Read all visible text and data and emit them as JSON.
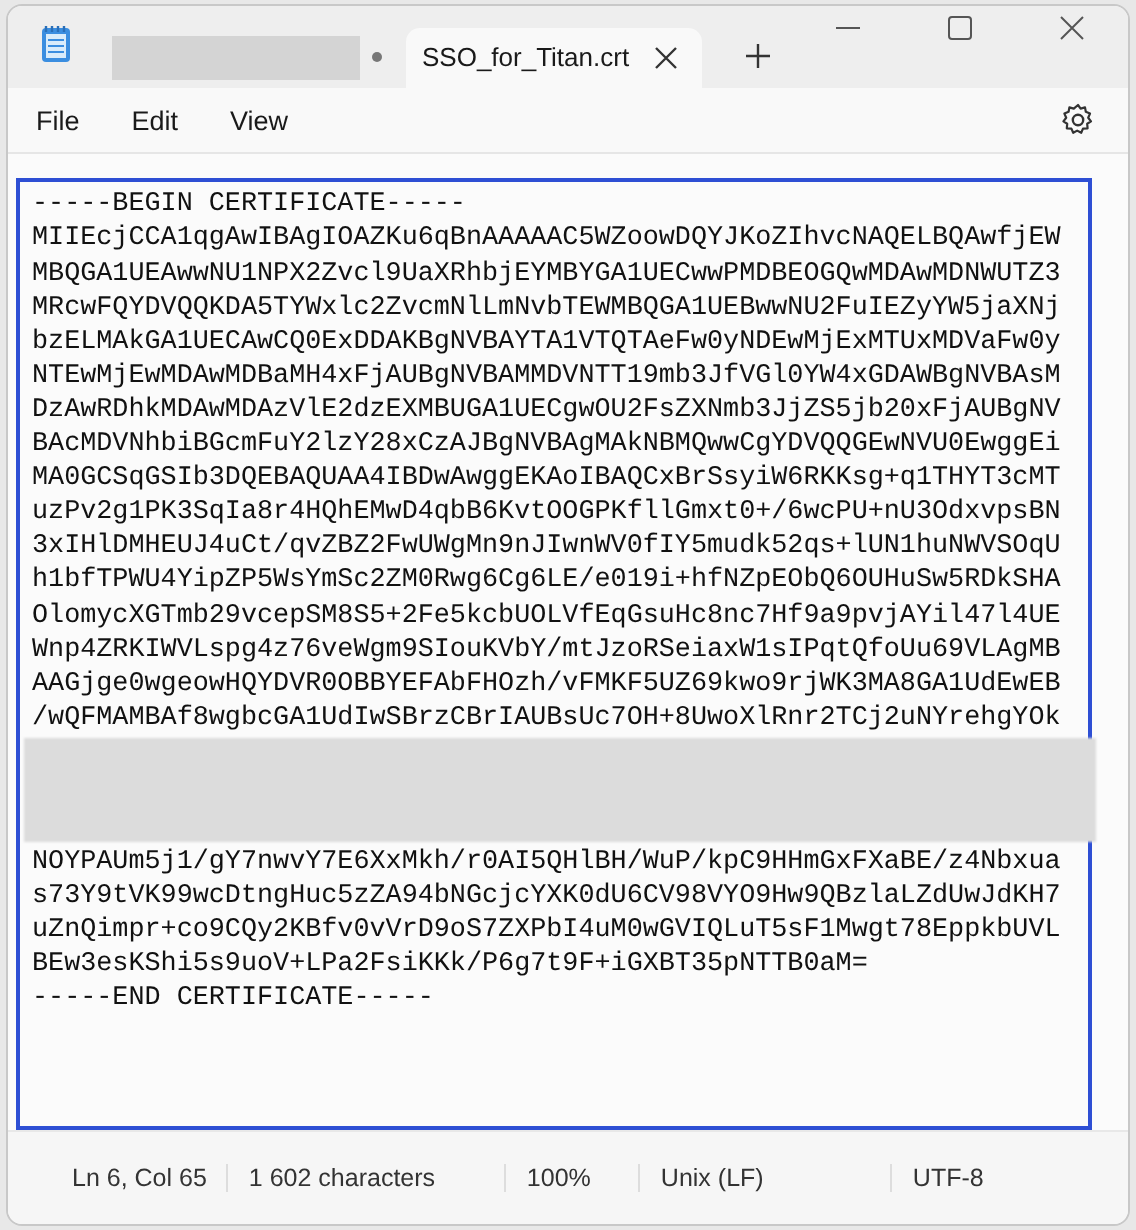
{
  "tabs": [
    {
      "kind": "redacted",
      "unsaved": true,
      "selected": false
    },
    {
      "kind": "file",
      "title": "SSO_for_Titan.crt",
      "selected": true
    }
  ],
  "menu": [
    "File",
    "Edit",
    "View"
  ],
  "editor": {
    "highlighted": true,
    "lines": [
      {
        "kind": "text",
        "text": "-----BEGIN CERTIFICATE-----"
      },
      {
        "kind": "text",
        "text": "MIIEcjCCA1qgAwIBAgIOAZKu6qBnAAAAAC5WZoowDQYJKoZIhvcNAQELBQAwfjEW"
      },
      {
        "kind": "text",
        "text": "MBQGA1UEAwwNU1NPX2Zvcl9UaXRhbjEYMBYGA1UECwwPMDBEOGQwMDAwMDNWUTZ3"
      },
      {
        "kind": "text",
        "text": "MRcwFQYDVQQKDA5TYWxlc2ZvcmNlLmNvbTEWMBQGA1UEBwwNU2FuIEZyYW5jaXNj"
      },
      {
        "kind": "text",
        "text": "bzELMAkGA1UECAwCQ0ExDDAKBgNVBAYTA1VTQTAeFw0yNDEwMjExMTUxMDVaFw0y"
      },
      {
        "kind": "text",
        "text": "NTEwMjEwMDAwMDBaMH4xFjAUBgNVBAMMDVNTT19mb3JfVGl0YW4xGDAWBgNVBAsM"
      },
      {
        "kind": "text",
        "text": "DzAwRDhkMDAwMDAzVlE2dzEXMBUGA1UECgwOU2FsZXNmb3JjZS5jb20xFjAUBgNV"
      },
      {
        "kind": "text",
        "text": "BAcMDVNhbiBGcmFuY2lzY28xCzAJBgNVBAgMAkNBMQwwCgYDVQQGEwNVU0EwggEi"
      },
      {
        "kind": "text",
        "text": "MA0GCSqGSIb3DQEBAQUAA4IBDwAwggEKAoIBAQCxBrSsyiW6RKKsg+q1THYT3cMT"
      },
      {
        "kind": "text",
        "text": "uzPv2g1PK3SqIa8r4HQhEMwD4qbB6KvtOOGPKfllGmxt0+/6wcPU+nU3OdxvpsBN"
      },
      {
        "kind": "text",
        "text": "3xIHlDMHEUJ4uCt/qvZBZ2FwUWgMn9nJIwnWV0fIY5mudk52qs+lUN1huNWVSOqU"
      },
      {
        "kind": "text",
        "text": "h1bfTPWU4YipZP5WsYmSc2ZM0Rwg6Cg6LE/e019i+hfNZpEObQ6OUHuSw5RDkSHA"
      },
      {
        "kind": "text",
        "text": "OlomycXGTmb29vcepSM8S5+2Fe5kcbUOLVfEqGsuHc8nc7Hf9a9pvjAYil47l4UE"
      },
      {
        "kind": "text",
        "text": "Wnp4ZRKIWVLspg4z76veWgm9SIouKVbY/mtJzoRSeiaxW1sIPqtQfoUu69VLAgMB"
      },
      {
        "kind": "text",
        "text": "AAGjge0wgeowHQYDVR0OBBYEFAbFHOzh/vFMKF5UZ69kwo9rjWK3MA8GA1UdEwEB"
      },
      {
        "kind": "text",
        "text": "/wQFMAMBAf8wgbcGA1UdIwSBrzCBrIAUBsUc7OH+8UwoXlRnr2TCj2uNYrehgYOk"
      },
      {
        "kind": "redacted"
      },
      {
        "kind": "text",
        "text": "NOYPAUm5j1/gY7nwvY7E6XxMkh/r0AI5QHlBH/WuP/kpC9HHmGxFXaBE/z4Nbxua"
      },
      {
        "kind": "text",
        "text": "s73Y9tVK99wcDtngHuc5zZA94bNGcjcYXK0dU6CV98VYO9Hw9QBzlaLZdUwJdKH7"
      },
      {
        "kind": "text",
        "text": "uZnQimpr+co9CQy2KBfv0vVrD9oS7ZXPbI4uM0wGVIQLuT5sF1Mwgt78EppkbUVL"
      },
      {
        "kind": "text",
        "text": "BEw3esKShi5s9uoV+LPa2FsiKKk/P6g7t9F+iGXBT35pNTTB0aM="
      },
      {
        "kind": "text",
        "text": "-----END CERTIFICATE-----"
      }
    ]
  },
  "status_bar": [
    "Ln 6, Col 65",
    "1 602 characters",
    "100%",
    "Unix (LF)",
    "UTF-8"
  ]
}
